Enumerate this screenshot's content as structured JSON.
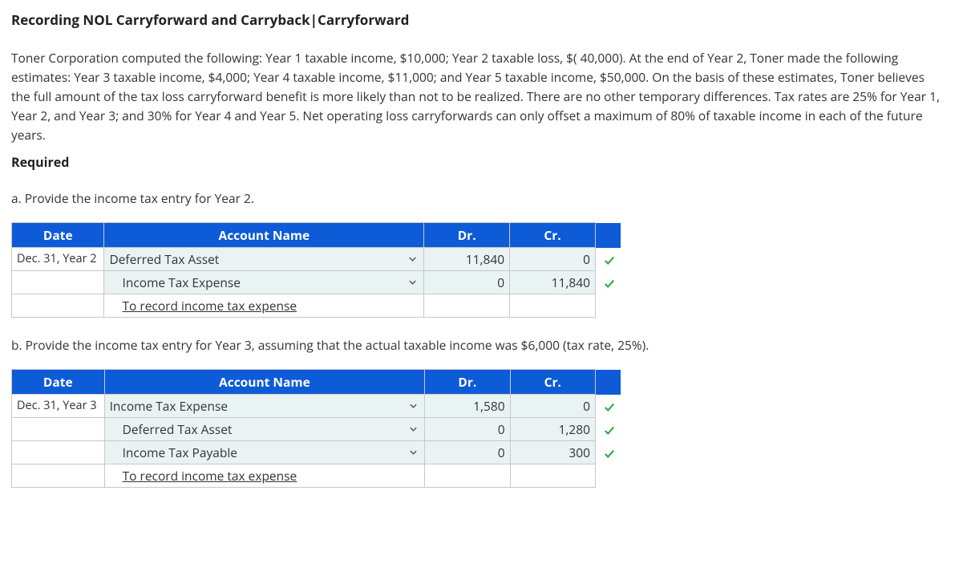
{
  "title": "Recording NOL Carryforward and Carryback|Carryforward",
  "problem_text": "Toner Corporation computed the following: Year 1 taxable income, $10,000; Year 2 taxable loss, $( 40,000). At the end of Year 2, Toner made the following estimates: Year 3 taxable income, $4,000; Year 4 taxable income, $11,000; and Year 5 taxable income, $50,000. On the basis of these estimates, Toner believes the full amount of the tax loss carryforward benefit is more likely than not to be realized. There are no other temporary differences. Tax rates are 25% for Year 1, Year 2, and Year 3; and 30% for Year 4 and Year 5. Net operating loss carryforwards can only offset a maximum of 80% of taxable income in each of the future years.",
  "required_label": "Required",
  "headers": {
    "date": "Date",
    "account": "Account Name",
    "dr": "Dr.",
    "cr": "Cr."
  },
  "part_a": {
    "label": "a. Provide the income tax entry for Year 2.",
    "rows": [
      {
        "date": "Dec. 31, Year 2",
        "account": "Deferred Tax Asset",
        "indent": 0,
        "dropdown": true,
        "dr": "11,840",
        "cr": "0",
        "check": true
      },
      {
        "date": "",
        "account": "Income Tax Expense",
        "indent": 1,
        "dropdown": true,
        "dr": "0",
        "cr": "11,840",
        "check": true
      },
      {
        "date": "",
        "account": "To record income tax expense",
        "indent": 1,
        "dropdown": false,
        "memo": true
      }
    ]
  },
  "part_b": {
    "label": "b. Provide the income tax entry for Year 3, assuming that the actual taxable income was $6,000 (tax rate, 25%).",
    "rows": [
      {
        "date": "Dec. 31, Year 3",
        "account": "Income Tax Expense",
        "indent": 0,
        "dropdown": true,
        "dr": "1,580",
        "cr": "0",
        "check": true
      },
      {
        "date": "",
        "account": "Deferred Tax Asset",
        "indent": 1,
        "dropdown": true,
        "dr": "0",
        "cr": "1,280",
        "check": true
      },
      {
        "date": "",
        "account": "Income Tax Payable",
        "indent": 1,
        "dropdown": true,
        "dr": "0",
        "cr": "300",
        "check": true
      },
      {
        "date": "",
        "account": "To record income tax expense",
        "indent": 1,
        "dropdown": false,
        "memo": true
      }
    ]
  }
}
